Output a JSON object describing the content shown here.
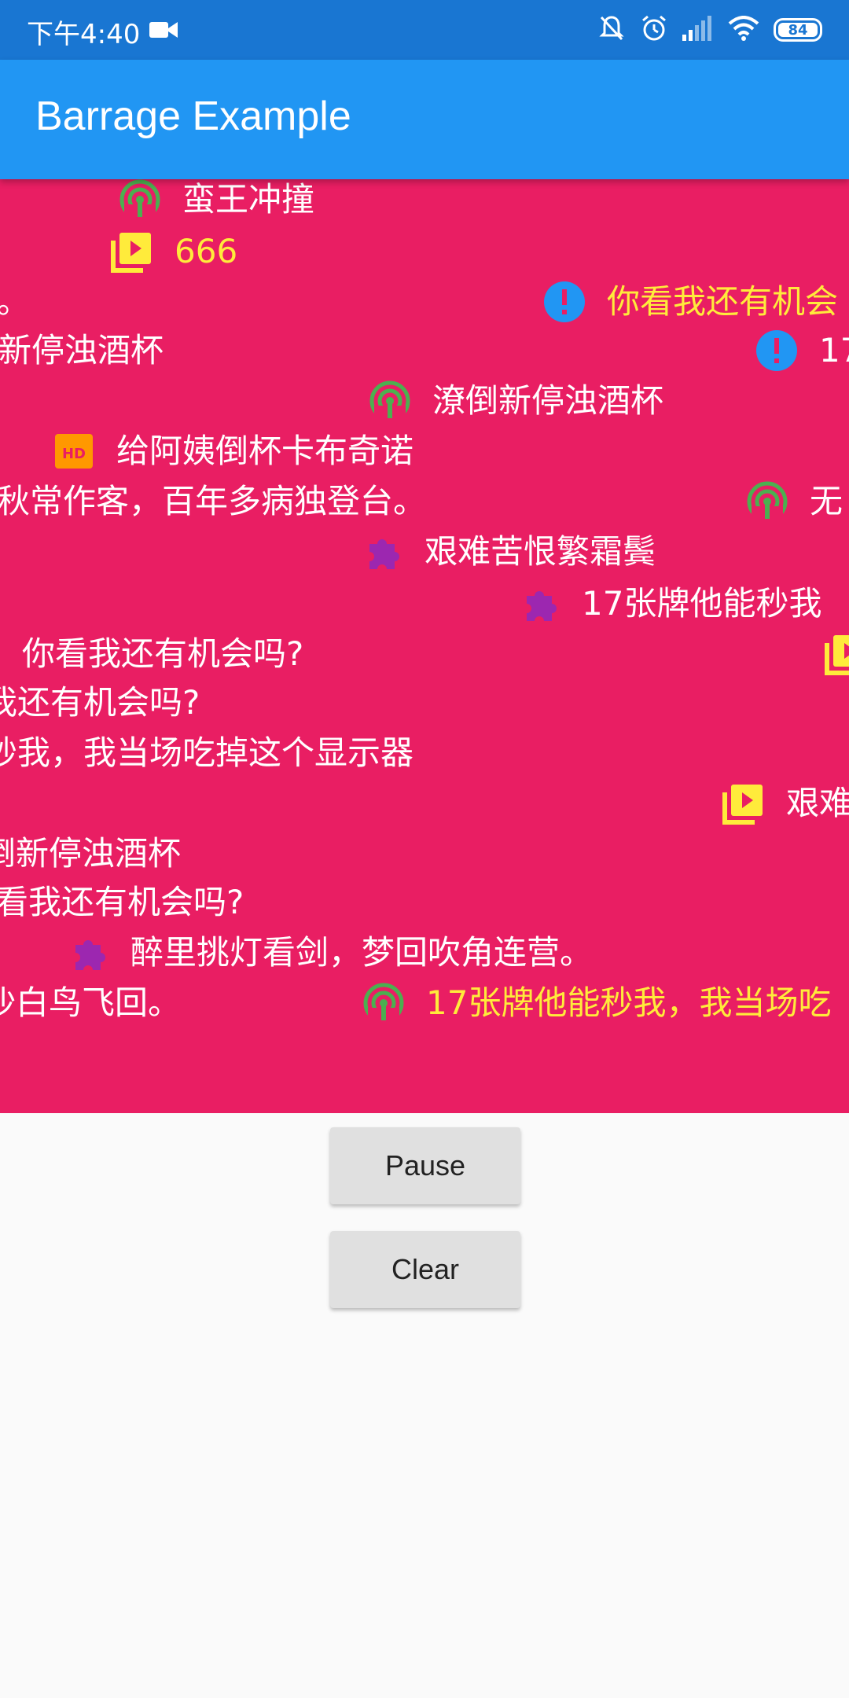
{
  "status_bar": {
    "time": "下午4:40",
    "battery": "84"
  },
  "app_bar": {
    "title": "Barrage Example"
  },
  "barrage": {
    "items": [
      {
        "text": "蛮王冲撞",
        "icon": "signal-icon",
        "color": "white"
      },
      {
        "text": "666",
        "icon": "video-library-icon",
        "color": "yellow"
      },
      {
        "text": "。",
        "icon": "",
        "color": "white"
      },
      {
        "text": "你看我还有机会",
        "icon": "alert-icon",
        "color": "yellow"
      },
      {
        "text": "新停浊酒杯",
        "icon": "",
        "color": "white"
      },
      {
        "text": "17",
        "icon": "alert-icon",
        "color": "white"
      },
      {
        "text": "潦倒新停浊酒杯",
        "icon": "signal-icon",
        "color": "white"
      },
      {
        "text": "给阿姨倒杯卡布奇诺",
        "icon": "hd-icon",
        "color": "white"
      },
      {
        "text": "秋常作客，百年多病独登台。",
        "icon": "",
        "color": "white"
      },
      {
        "text": "无",
        "icon": "signal-icon",
        "color": "white"
      },
      {
        "text": "艰难苦恨繁霜鬓",
        "icon": "puzzle-icon",
        "color": "white"
      },
      {
        "text": "17张牌他能秒我",
        "icon": "puzzle-icon",
        "color": "white"
      },
      {
        "text": "你看我还有机会吗?",
        "icon": "video-library-icon",
        "color": "white"
      },
      {
        "text": "",
        "icon": "video-library-icon",
        "color": "yellow"
      },
      {
        "text": "我还有机会吗?",
        "icon": "",
        "color": "white"
      },
      {
        "text": "秒我，我当场吃掉这个显示器",
        "icon": "",
        "color": "white"
      },
      {
        "text": "艰难",
        "icon": "video-library-icon",
        "color": "white"
      },
      {
        "text": "倒新停浊酒杯",
        "icon": "",
        "color": "white"
      },
      {
        "text": "看我还有机会吗?",
        "icon": "",
        "color": "white"
      },
      {
        "text": "醉里挑灯看剑，梦回吹角连营。",
        "icon": "puzzle-icon",
        "color": "white"
      },
      {
        "text": "沙白鸟飞回。",
        "icon": "",
        "color": "white"
      },
      {
        "text": "17张牌他能秒我，我当场吃",
        "icon": "signal-icon",
        "color": "yellow"
      }
    ]
  },
  "controls": {
    "pause_label": "Pause",
    "clear_label": "Clear"
  },
  "colors": {
    "status_bar": "#1976d2",
    "app_bar": "#2196f3",
    "barrage_bg": "#e91e63",
    "yellow_text": "#ffeb3b",
    "alert_blue": "#2196f3",
    "signal_green": "#4caf50",
    "puzzle_purple": "#9c27b0"
  }
}
